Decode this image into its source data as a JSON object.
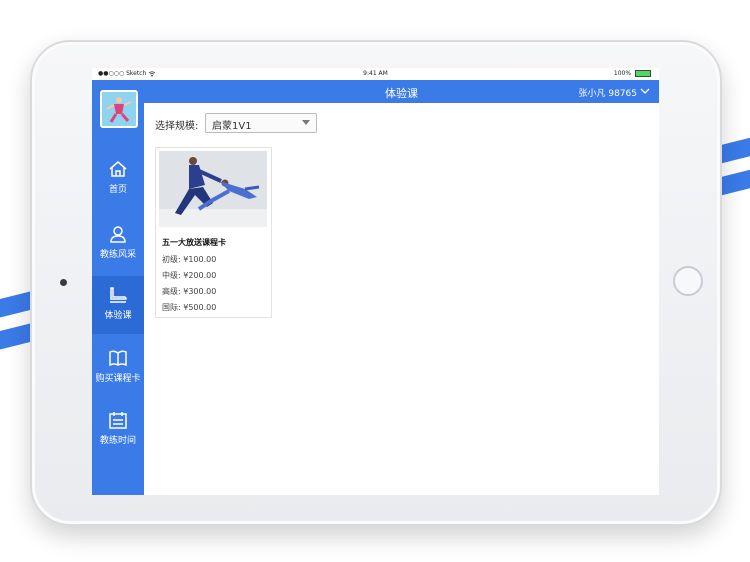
{
  "status_bar": {
    "carrier": "●●○○○ Sketch",
    "wifi_icon": "wifi-icon",
    "time": "9:41 AM",
    "battery": "100%"
  },
  "sidebar": {
    "items": [
      {
        "label": "首页",
        "icon": "home-icon"
      },
      {
        "label": "教练风采",
        "icon": "person-icon"
      },
      {
        "label": "体验课",
        "icon": "skate-icon"
      },
      {
        "label": "购买课程卡",
        "icon": "book-icon"
      },
      {
        "label": "教练时间",
        "icon": "calendar-icon"
      }
    ],
    "active_index": 2
  },
  "header": {
    "title": "体验课",
    "user": "张小凡 98765"
  },
  "filter": {
    "label": "选择规模:",
    "selected": "启蒙1V1"
  },
  "cards": [
    {
      "name": "五一大放送课程卡",
      "prices": [
        "初级: ¥100.00",
        "中级: ¥200.00",
        "高级: ¥300.00",
        "国际: ¥500.00"
      ]
    }
  ],
  "colors": {
    "accent": "#3b7be8",
    "accent_dark": "#2c6ad6"
  }
}
